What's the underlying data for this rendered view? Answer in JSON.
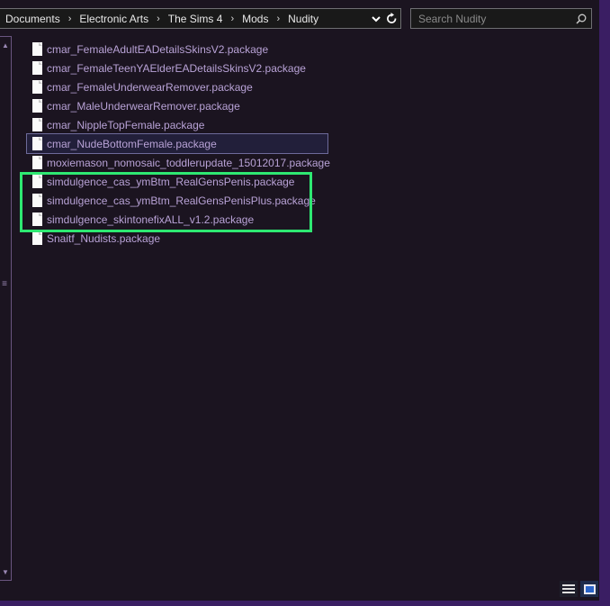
{
  "address_bar": {
    "breadcrumbs": [
      "Documents",
      "Electronic Arts",
      "The Sims 4",
      "Mods",
      "Nudity"
    ],
    "separator": "›",
    "dropdown_icon": "chevron-down-icon",
    "refresh_icon": "refresh-icon"
  },
  "search": {
    "placeholder": "Search Nudity",
    "icon": "search-icon"
  },
  "files": [
    {
      "name": "cmar_FemaleAdultEADetailsSkinsV2.package",
      "selected": false
    },
    {
      "name": "cmar_FemaleTeenYAElderEADetailsSkinsV2.package",
      "selected": false
    },
    {
      "name": "cmar_FemaleUnderwearRemover.package",
      "selected": false
    },
    {
      "name": "cmar_MaleUnderwearRemover.package",
      "selected": false
    },
    {
      "name": "cmar_NippleTopFemale.package",
      "selected": false
    },
    {
      "name": "cmar_NudeBottomFemale.package",
      "selected": true
    },
    {
      "name": "moxiemason_nomosaic_toddlerupdate_15012017.package",
      "selected": false
    },
    {
      "name": "simdulgence_cas_ymBtm_RealGensPenis.package",
      "selected": false
    },
    {
      "name": "simdulgence_cas_ymBtm_RealGensPenisPlus.package",
      "selected": false
    },
    {
      "name": "simdulgence_skintonefixALL_v1.2.package",
      "selected": false
    },
    {
      "name": "Snaitf_Nudists.package",
      "selected": false
    }
  ],
  "view_buttons": {
    "details_icon": "details-view-icon",
    "large_icon": "large-icons-view-icon"
  },
  "colors": {
    "background": "#1b1420",
    "frame": "#3a1e63",
    "file_text": "#b8a2d6",
    "highlight": "#2ee872"
  }
}
